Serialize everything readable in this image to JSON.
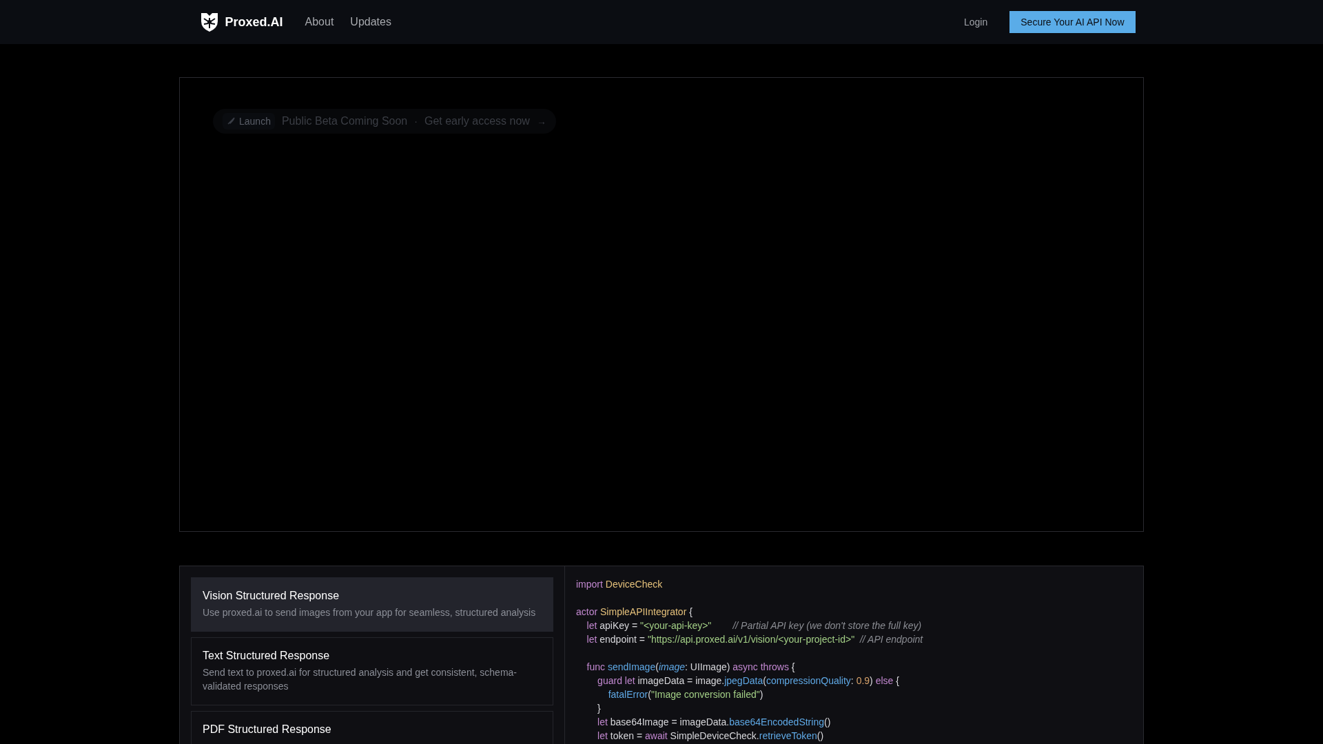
{
  "nav": {
    "brand": "Proxed.AI",
    "links": [
      "About",
      "Updates"
    ],
    "login": "Login",
    "cta": "Secure Your AI API Now"
  },
  "announcement": {
    "tag": "Launch",
    "message": "Public Beta Coming Soon",
    "separator": "·",
    "link": "Get early access now",
    "arrow": "→"
  },
  "features": [
    {
      "title": "Vision Structured Response",
      "description": "Use proxed.ai to send images from your app for seamless, structured analysis",
      "selected": true
    },
    {
      "title": "Text Structured Response",
      "description": "Send text to proxed.ai for structured analysis and get consistent, schema-validated responses",
      "selected": false
    },
    {
      "title": "PDF Structured Response",
      "selected": false
    }
  ],
  "code": [
    {
      "kind": "line",
      "tokens": [
        {
          "text": "import ",
          "kind": "kw"
        },
        {
          "text": "DeviceCheck",
          "kind": "type"
        }
      ]
    },
    {
      "kind": "blank"
    },
    {
      "kind": "line",
      "tokens": [
        {
          "text": "actor ",
          "kind": "kw"
        },
        {
          "text": "SimpleAPIIntegrator",
          "kind": "type"
        },
        {
          "text": " {",
          "kind": "plain"
        }
      ]
    },
    {
      "kind": "line",
      "tokens": [
        {
          "text": "    let ",
          "kind": "kw"
        },
        {
          "text": "apiKey = ",
          "kind": "plain"
        },
        {
          "text": "\"<your-api-key>\"",
          "kind": "str"
        },
        {
          "text": "        // Partial API key (we don't store the full key)",
          "kind": "comment"
        }
      ]
    },
    {
      "kind": "line",
      "tokens": [
        {
          "text": "    let ",
          "kind": "kw"
        },
        {
          "text": "endpoint = ",
          "kind": "plain"
        },
        {
          "text": "\"https://api.proxed.ai/v1/vision/<your-project-id>\"",
          "kind": "str"
        },
        {
          "text": "  // API endpoint",
          "kind": "comment"
        }
      ]
    },
    {
      "kind": "blank"
    },
    {
      "kind": "line",
      "tokens": [
        {
          "text": "    func ",
          "kind": "kw"
        },
        {
          "text": "sendImage",
          "kind": "fn"
        },
        {
          "text": "(",
          "kind": "plain"
        },
        {
          "text": "image",
          "kind": "param"
        },
        {
          "text": ": UIImage) ",
          "kind": "plain"
        },
        {
          "text": "async throws",
          "kind": "kw"
        },
        {
          "text": " {",
          "kind": "plain"
        }
      ]
    },
    {
      "kind": "line",
      "tokens": [
        {
          "text": "        guard let ",
          "kind": "kw"
        },
        {
          "text": "imageData = image.",
          "kind": "plain"
        },
        {
          "text": "jpegData",
          "kind": "fn"
        },
        {
          "text": "(",
          "kind": "plain"
        },
        {
          "text": "compressionQuality",
          "kind": "fn"
        },
        {
          "text": ": ",
          "kind": "plain"
        },
        {
          "text": "0.9",
          "kind": "num"
        },
        {
          "text": ") ",
          "kind": "plain"
        },
        {
          "text": "else",
          "kind": "kw"
        },
        {
          "text": " {",
          "kind": "plain"
        }
      ]
    },
    {
      "kind": "line",
      "tokens": [
        {
          "text": "            fatalError",
          "kind": "fn"
        },
        {
          "text": "(",
          "kind": "plain"
        },
        {
          "text": "\"Image conversion failed\"",
          "kind": "str"
        },
        {
          "text": ")",
          "kind": "plain"
        }
      ]
    },
    {
      "kind": "line",
      "tokens": [
        {
          "text": "        }",
          "kind": "plain"
        }
      ]
    },
    {
      "kind": "line",
      "tokens": [
        {
          "text": "        let ",
          "kind": "kw"
        },
        {
          "text": "base64Image = imageData.",
          "kind": "plain"
        },
        {
          "text": "base64EncodedString",
          "kind": "fn"
        },
        {
          "text": "()",
          "kind": "plain"
        }
      ]
    },
    {
      "kind": "line",
      "tokens": [
        {
          "text": "        let ",
          "kind": "kw"
        },
        {
          "text": "token = ",
          "kind": "plain"
        },
        {
          "text": "await ",
          "kind": "kw"
        },
        {
          "text": "SimpleDeviceCheck.",
          "kind": "plain"
        },
        {
          "text": "retrieveToken",
          "kind": "fn"
        },
        {
          "text": "()",
          "kind": "plain"
        }
      ]
    }
  ]
}
